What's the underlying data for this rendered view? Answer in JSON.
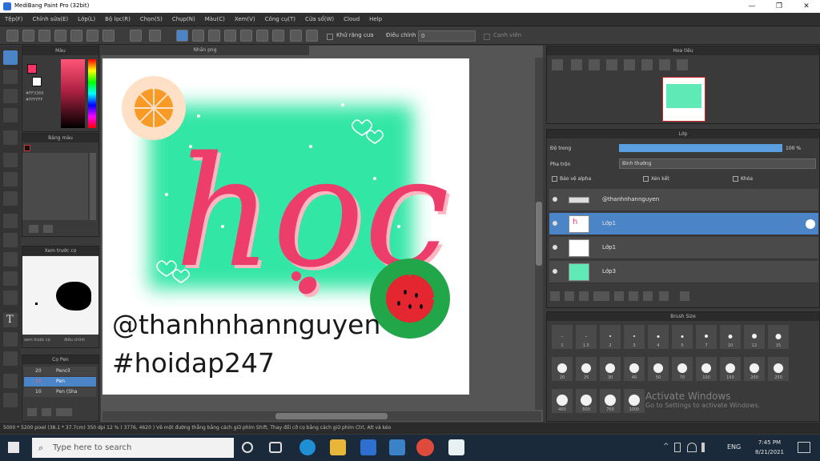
{
  "window": {
    "title": "MediBang Paint Pro (32bit)",
    "min": "—",
    "max": "❐",
    "close": "✕"
  },
  "menu": [
    "Tệp(F)",
    "Chỉnh sửa(E)",
    "Lớp(L)",
    "Bộ lọc(R)",
    "Chọn(S)",
    "Chụp(N)",
    "Màu(C)",
    "Xem(V)",
    "Công cụ(T)",
    "Cửa sổ(W)",
    "Cloud",
    "Help"
  ],
  "toolbar": {
    "antialias_label": "Khử răng cưa",
    "correction_label": "Điều chỉnh",
    "correction_value": "0",
    "edge_label": "Cạnh viền"
  },
  "panels": {
    "color": "Màu",
    "color_palette": "Bảng màu",
    "preview_panel": "Xem trước cọ",
    "brush_list": "Cọ Pen",
    "navigator": "Hoa tiêu",
    "layers": "Lớp",
    "brush_size": "Brush Size",
    "canvas_tab": "Nhãn png"
  },
  "color_hex": {
    "line1": "#FF3366",
    "line2": "#FFFFFF"
  },
  "brush_list": [
    {
      "size": "20",
      "name": "Pencil"
    },
    {
      "size": "15",
      "name": "Pen"
    },
    {
      "size": "10",
      "name": "Pen (Sha"
    }
  ],
  "preview_tabs": {
    "left": "xem trước cọ",
    "right": "điều chỉnh"
  },
  "layers": {
    "opacity_label": "Độ trong",
    "opacity_value": "100 %",
    "blend_label": "Pha trộn",
    "blend_value": "Bình thường",
    "protect_alpha": "Bảo vệ alpha",
    "clipping": "Xén kết",
    "lock": "Khóa",
    "items": [
      {
        "name": "@thanhnhannguyen",
        "selected": false
      },
      {
        "name": "Lớp1",
        "selected": true
      },
      {
        "name": "Lớp1",
        "selected": false
      },
      {
        "name": "Lớp3",
        "selected": false
      }
    ]
  },
  "brush_sizes": {
    "row1": [
      "1",
      "1.5",
      "2",
      "3",
      "4",
      "5",
      "7",
      "10",
      "12",
      "15"
    ],
    "row2": [
      "20",
      "25",
      "30",
      "40",
      "50",
      "70",
      "100",
      "150",
      "200",
      "250"
    ],
    "row3": [
      "400",
      "500",
      "700",
      "1000"
    ]
  },
  "artwork": {
    "word": "học",
    "handle": "@thanhnhannguyen",
    "hashtag": "#hoidap247"
  },
  "statusbar": "5000 * 5200 pixel  (38.1 * 37.7cm)  350 dpi  12 %  ( 3776, 4620 )  Vẽ một đường thẳng bằng cách giữ phím Shift, Thay đổi cỡ cọ bằng cách giữ phím Ctrl, Alt và kéo",
  "taskbar": {
    "search_placeholder": "Type here to search",
    "lang": "ENG",
    "time": "7:45 PM",
    "date": "8/21/2021"
  },
  "watermark": {
    "line1": "Activate Windows",
    "line2": "Go to Settings to activate Windows."
  }
}
